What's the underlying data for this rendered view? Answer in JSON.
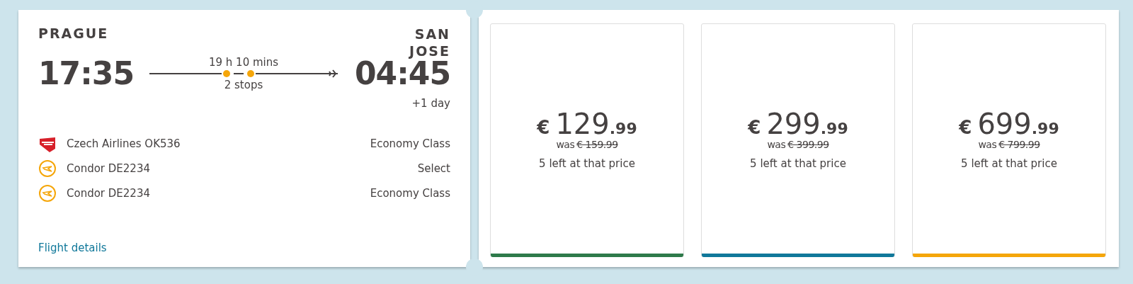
{
  "flight": {
    "origin": "PRAGUE",
    "destination": "SAN JOSE",
    "depart_time": "17:35",
    "arrive_time": "04:45",
    "duration": "19 h 10 mins",
    "stops": "2 stops",
    "day_offset": "+1 day",
    "segments": [
      {
        "kind": "csa",
        "flight": "Czech Airlines OK536",
        "cabin": "Economy Class"
      },
      {
        "kind": "condor",
        "flight": "Condor DE2234",
        "cabin": "Select"
      },
      {
        "kind": "condor",
        "flight": "Condor DE2234",
        "cabin": "Economy Class"
      }
    ],
    "details_link": "Flight details"
  },
  "fares": [
    {
      "currency": "€",
      "amount": "129",
      "cents": ".99",
      "was": "was",
      "old_price": "€ 159.99",
      "availability": "5 left at that price",
      "color": "#2e7a4a"
    },
    {
      "currency": "€",
      "amount": "299",
      "cents": ".99",
      "was": "was",
      "old_price": "€ 399.99",
      "availability": "5 left at that price",
      "color": "#10789a"
    },
    {
      "currency": "€",
      "amount": "699",
      "cents": ".99",
      "was": "was",
      "old_price": "€ 799.99",
      "availability": "5 left at that price",
      "color": "#f5a60a"
    }
  ]
}
